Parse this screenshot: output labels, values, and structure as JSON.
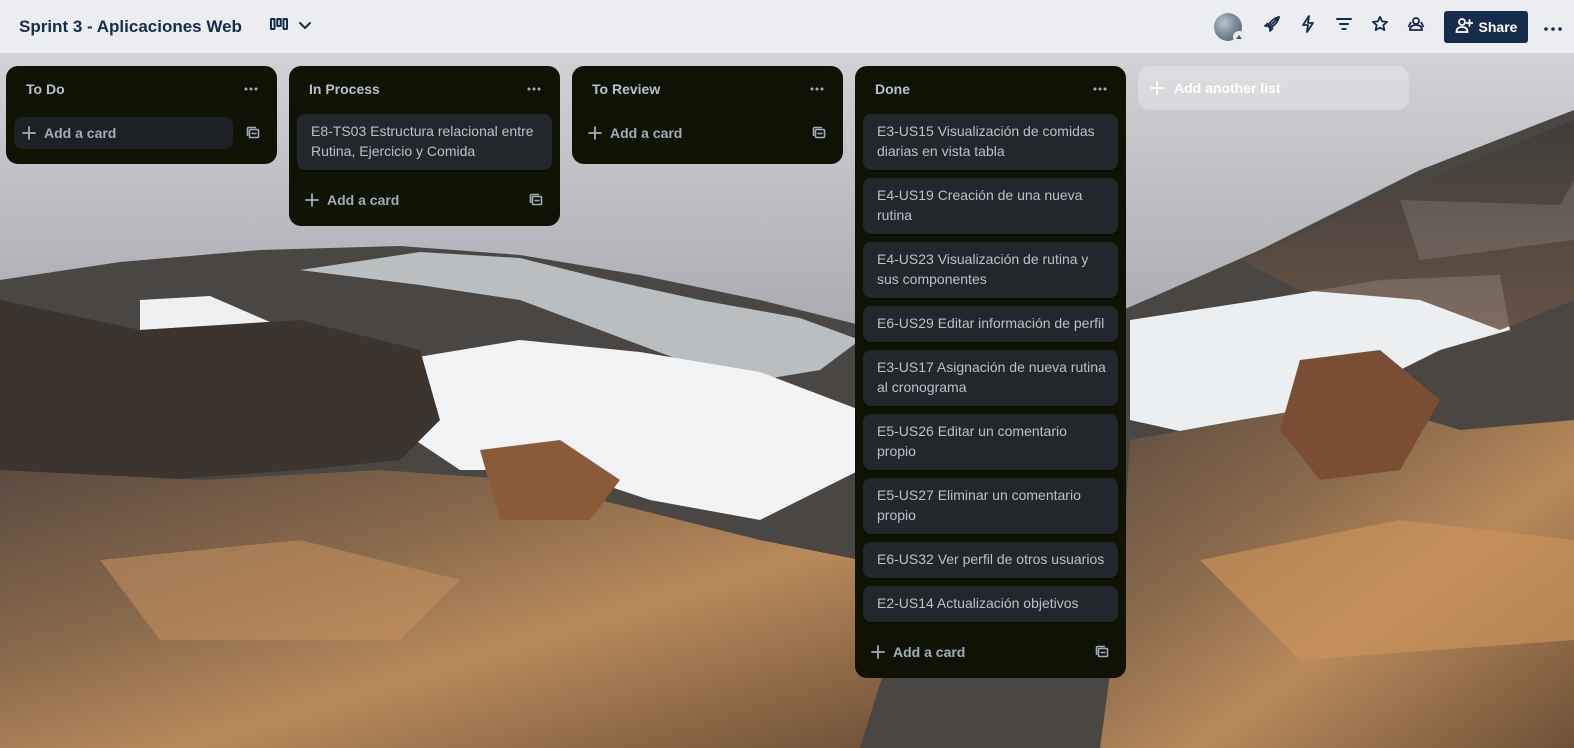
{
  "board": {
    "title": "Sprint 3 - Aplicaciones Web"
  },
  "header": {
    "share_label": "Share",
    "icons": [
      "board-view-icon",
      "chevron-down-icon",
      "avatar",
      "power-ups-icon",
      "automation-icon",
      "filter-icon",
      "star-icon",
      "visibility-icon",
      "add-member-icon",
      "more-icon"
    ]
  },
  "lists": [
    {
      "title": "To Do",
      "cards": [],
      "add_label": "Add a card"
    },
    {
      "title": "In Process",
      "cards": [
        "E8-TS03 Estructura relacional entre Rutina, Ejercicio y Comida"
      ],
      "add_label": "Add a card"
    },
    {
      "title": "To Review",
      "cards": [],
      "add_label": "Add a card"
    },
    {
      "title": "Done",
      "cards": [
        "E3-US15 Visualización de comidas diarias en vista tabla",
        "E4-US19 Creación de una nueva rutina",
        "E4-US23 Visualización de rutina y sus componentes",
        "E6-US29 Editar información de perfil",
        "E3-US17 Asignación de nueva rutina al cronograma",
        "E5-US26 Editar un comentario propio",
        "E5-US27 Eliminar un comentario propio",
        "E6-US32 Ver perfil de otros usuarios",
        "E2-US14 Actualización objetivos"
      ],
      "add_label": "Add a card"
    }
  ],
  "add_list_label": "Add another list",
  "colors": {
    "header_bg": "#eeeff2",
    "title_text": "#172b4d",
    "list_bg": "#101204",
    "card_bg": "#22272b",
    "card_text": "#b6c2cf",
    "share_bg": "#172b4d"
  }
}
